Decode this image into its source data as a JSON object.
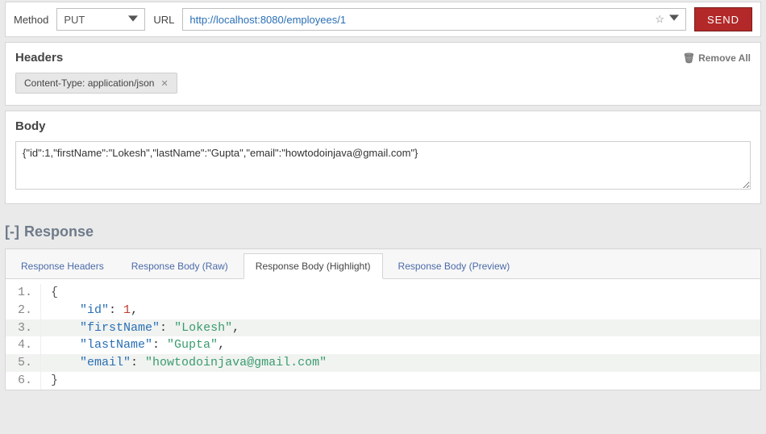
{
  "request": {
    "method_label": "Method",
    "method_value": "PUT",
    "url_label": "URL",
    "url_value": "http://localhost:8080/employees/1",
    "send_label": "SEND"
  },
  "headers_panel": {
    "title": "Headers",
    "remove_all": "Remove All",
    "items": [
      {
        "text": "Content-Type: application/json"
      }
    ]
  },
  "body_panel": {
    "title": "Body",
    "value": "{\"id\":1,\"firstName\":\"Lokesh\",\"lastName\":\"Gupta\",\"email\":\"howtodoinjava@gmail.com\"}"
  },
  "response": {
    "toggle": "[-]",
    "title": "Response",
    "tabs": [
      {
        "label": "Response Headers",
        "active": false
      },
      {
        "label": "Response Body (Raw)",
        "active": false
      },
      {
        "label": "Response Body (Highlight)",
        "active": true
      },
      {
        "label": "Response Body (Preview)",
        "active": false
      }
    ],
    "code_lines": [
      {
        "n": "1.",
        "hl": false,
        "tokens": [
          {
            "t": "{",
            "c": "brace"
          }
        ]
      },
      {
        "n": "2.",
        "hl": false,
        "tokens": [
          {
            "t": "    ",
            "c": "plain"
          },
          {
            "t": "\"id\"",
            "c": "key"
          },
          {
            "t": ": ",
            "c": "punc"
          },
          {
            "t": "1",
            "c": "num"
          },
          {
            "t": ",",
            "c": "punc"
          }
        ]
      },
      {
        "n": "3.",
        "hl": true,
        "tokens": [
          {
            "t": "    ",
            "c": "plain"
          },
          {
            "t": "\"firstName\"",
            "c": "key"
          },
          {
            "t": ": ",
            "c": "punc"
          },
          {
            "t": "\"Lokesh\"",
            "c": "str"
          },
          {
            "t": ",",
            "c": "punc"
          }
        ]
      },
      {
        "n": "4.",
        "hl": false,
        "tokens": [
          {
            "t": "    ",
            "c": "plain"
          },
          {
            "t": "\"lastName\"",
            "c": "key"
          },
          {
            "t": ": ",
            "c": "punc"
          },
          {
            "t": "\"Gupta\"",
            "c": "str"
          },
          {
            "t": ",",
            "c": "punc"
          }
        ]
      },
      {
        "n": "5.",
        "hl": true,
        "tokens": [
          {
            "t": "    ",
            "c": "plain"
          },
          {
            "t": "\"email\"",
            "c": "key"
          },
          {
            "t": ": ",
            "c": "punc"
          },
          {
            "t": "\"howtodoinjava@gmail.com\"",
            "c": "str"
          }
        ]
      },
      {
        "n": "6.",
        "hl": false,
        "tokens": [
          {
            "t": "}",
            "c": "brace"
          }
        ]
      }
    ]
  }
}
